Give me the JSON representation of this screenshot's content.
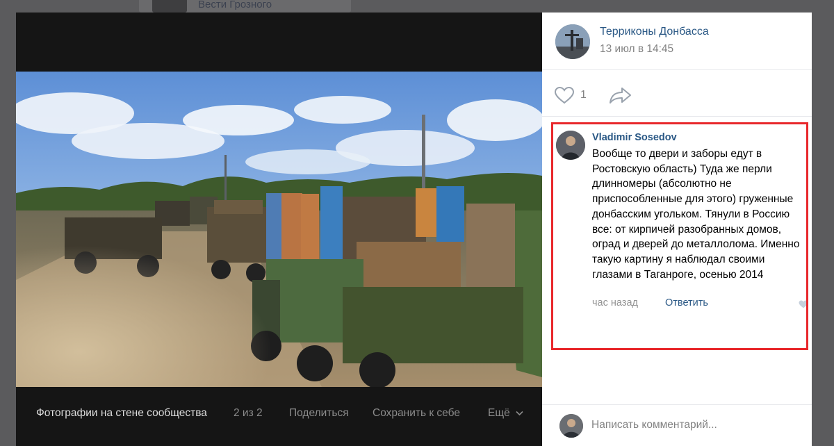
{
  "background": {
    "feed_title": "Вести Грозного"
  },
  "viewer": {
    "album_title": "Фотографии на стене сообщества",
    "counter": "2 из 2",
    "share_label": "Поделиться",
    "save_label": "Сохранить к себе",
    "more_label": "Ещё"
  },
  "post": {
    "group_name": "Терриконы Донбасса",
    "date": "13 июл в 14:45",
    "like_count": "1"
  },
  "comment": {
    "author": "Vladimir Sosedov",
    "text": "Вообще то двери и заборы едут в Ростовскую область) Туда же перли длинномеры (абсолютно не приспособленные для этого) груженные донбасским угольком. Тянули в Россию все: от кирпичей разобранных домов, оград и дверей до металлолома. Именно такую картину я наблюдал своими глазами в Таганроге, осенью 2014",
    "time": "час назад",
    "reply_label": "Ответить"
  },
  "composer": {
    "placeholder": "Написать комментарий..."
  },
  "colors": {
    "link": "#2a5885",
    "highlight": "#e8272b",
    "viewer_bg": "#151515"
  }
}
